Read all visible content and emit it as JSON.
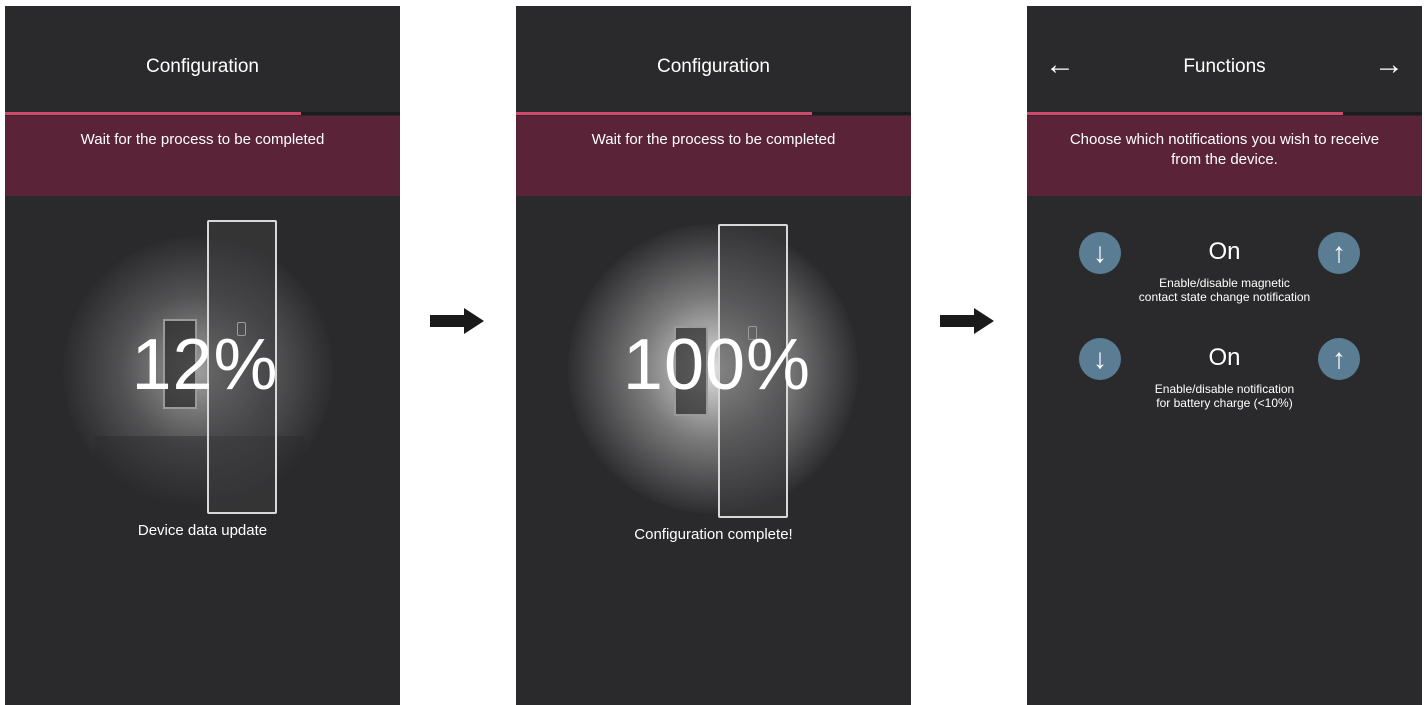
{
  "screen1": {
    "title": "Configuration",
    "progress": 0.75,
    "banner": "Wait for the process to be completed",
    "percent": "12%",
    "status": "Device data update"
  },
  "screen2": {
    "title": "Configuration",
    "progress": 0.75,
    "banner": "Wait for the process to be completed",
    "percent": "100%",
    "status": "Configuration complete!"
  },
  "screen3": {
    "title": "Functions",
    "progress": 0.8,
    "nav_back_icon": "arrow-left-icon",
    "nav_forward_icon": "arrow-right-icon",
    "banner": "Choose which notifications you wish to receive from the device.",
    "functions": [
      {
        "value": "On",
        "desc_line1": "Enable/disable magnetic",
        "desc_line2": "contact state change notification"
      },
      {
        "value": "On",
        "desc_line1": "Enable/disable notification",
        "desc_line2": "for battery charge (<10%)"
      }
    ]
  },
  "colors": {
    "screen_bg": "#2a2a2c",
    "banner_bg": "#5b2338",
    "progress": "#d4476d",
    "button": "#5a7d93"
  }
}
